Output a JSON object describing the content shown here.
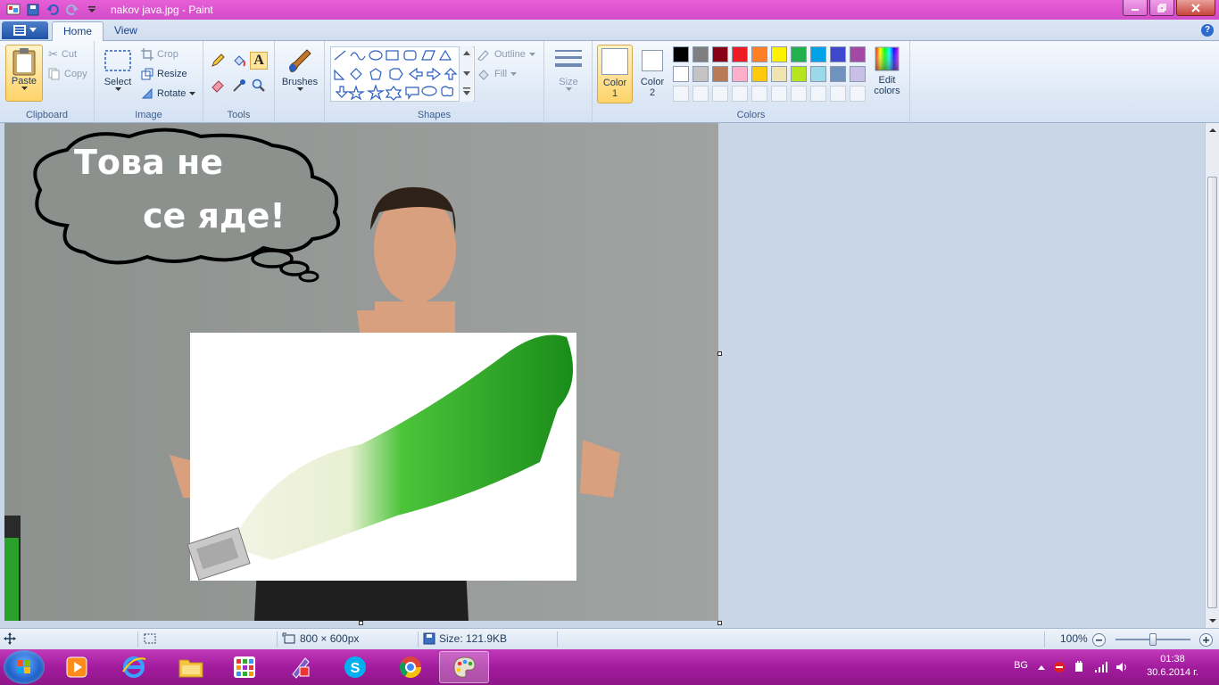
{
  "window": {
    "title": "nakov java.jpg - Paint"
  },
  "tabs": [
    {
      "label": "Home"
    },
    {
      "label": "View"
    }
  ],
  "clipboard": {
    "paste": "Paste",
    "cut": "Cut",
    "copy": "Copy",
    "group_label": "Clipboard"
  },
  "image": {
    "select": "Select",
    "crop": "Crop",
    "resize": "Resize",
    "rotate": "Rotate",
    "group_label": "Image"
  },
  "tools": {
    "group_label": "Tools",
    "items": [
      "pencil-icon",
      "fill-bucket-icon",
      "text-icon",
      "eraser-icon",
      "color-picker-icon",
      "magnifier-icon"
    ]
  },
  "brushes": {
    "label": "Brushes"
  },
  "shapes": {
    "group_label": "Shapes",
    "outline": "Outline",
    "fill": "Fill"
  },
  "size": {
    "label": "Size"
  },
  "colors": {
    "group_label": "Colors",
    "color1_label_line1": "Color",
    "color1_label_line2": "1",
    "color2_label_line1": "Color",
    "color2_label_line2": "2",
    "edit_line1": "Edit",
    "edit_line2": "colors",
    "color1": "#ffffff",
    "color2": "#ffffff",
    "palette_row1": [
      "#000000",
      "#7f7f7f",
      "#880015",
      "#ed1c24",
      "#ff7f27",
      "#fff200",
      "#22b14c",
      "#00a2e8",
      "#3f48cc",
      "#a349a4"
    ],
    "palette_row2": [
      "#ffffff",
      "#c3c3c3",
      "#b97a57",
      "#ffaec9",
      "#ffc90e",
      "#efe4b0",
      "#b5e61d",
      "#99d9ea",
      "#7092be",
      "#c8bfe7"
    ]
  },
  "canvas": {
    "bubble_line1": "Това не",
    "bubble_line2": "се яде!"
  },
  "status": {
    "dimensions": "800 × 600px",
    "size": "Size: 121.9KB",
    "zoom": "100%"
  },
  "taskbar": {
    "lang": "BG",
    "time": "01:38",
    "date": "30.6.2014 г."
  }
}
